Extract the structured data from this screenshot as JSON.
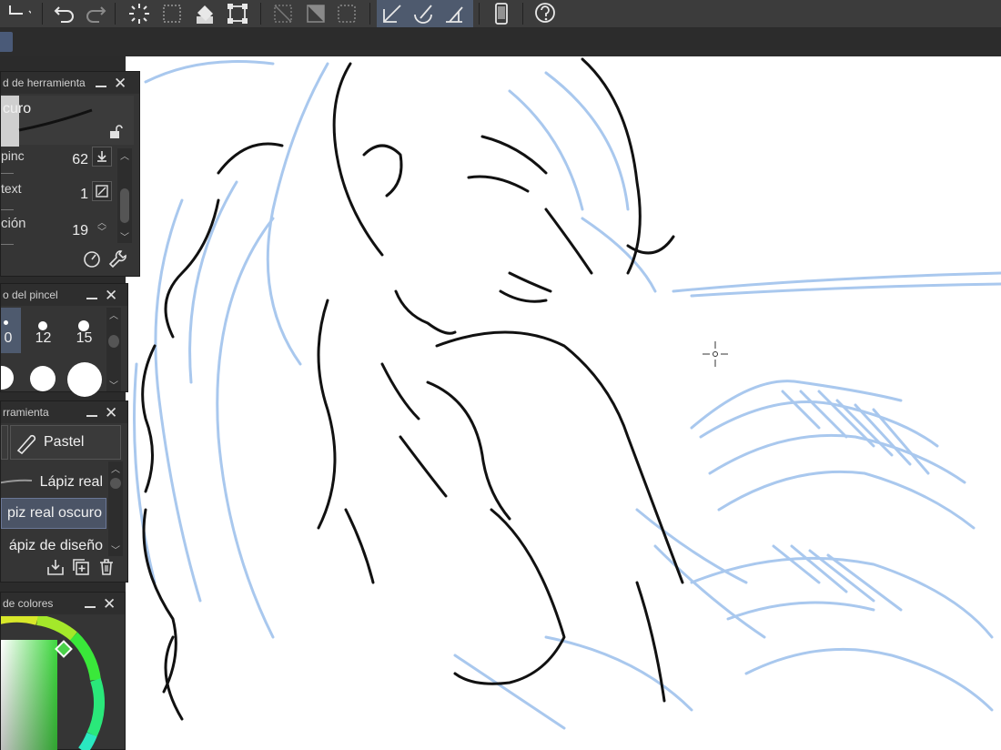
{
  "panels": {
    "tool_property": {
      "title": "d de herramienta",
      "preset_name": "curo",
      "rows": [
        {
          "label": "pinc",
          "value": "62"
        },
        {
          "label": "text",
          "value": "1"
        },
        {
          "label": "ción",
          "value": "19"
        }
      ]
    },
    "brush_size": {
      "title": "o del pincel",
      "sizes": [
        "0",
        "12",
        "15"
      ]
    },
    "sub_tool": {
      "title": "rramienta",
      "tab_label": "Pastel",
      "items": [
        "Lápiz real",
        "piz real oscuro",
        "ápiz de diseño"
      ],
      "selected_index": 1
    },
    "color": {
      "title": "de colores"
    }
  },
  "colors": {
    "accent": "#4e5a6e",
    "sketch_blue": "#a9c8ee",
    "ink": "#111111",
    "selected_item": "#4b5466"
  }
}
